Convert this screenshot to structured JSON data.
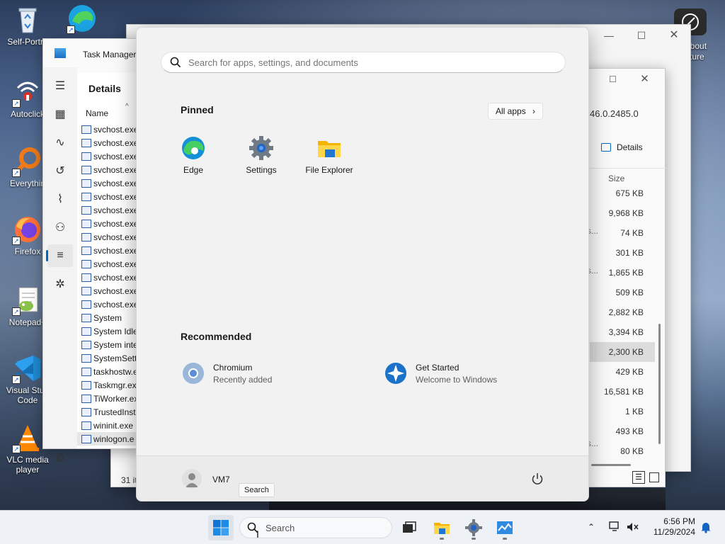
{
  "desktop": {
    "icons": [
      {
        "label": "Self-Portra",
        "icon": "recycle-bin-icon"
      },
      {
        "label": "Autoclick",
        "icon": "autoclick-icon"
      },
      {
        "label": "Everythin",
        "icon": "everything-search-icon"
      },
      {
        "label": "Firefox",
        "icon": "firefox-icon"
      },
      {
        "label": "Notepad+",
        "icon": "notepadpp-icon"
      },
      {
        "label": "Visual Stud Code",
        "icon": "vscode-icon"
      },
      {
        "label": "VLC media player",
        "icon": "vlc-icon"
      }
    ],
    "top_right_label": "dbout cture"
  },
  "task_manager": {
    "title": "Task Manager",
    "section": "Details",
    "column_name": "Name",
    "processes": [
      "svchost.exe",
      "svchost.exe",
      "svchost.exe",
      "svchost.exe",
      "svchost.exe",
      "svchost.exe",
      "svchost.exe",
      "svchost.exe",
      "svchost.exe",
      "svchost.exe",
      "svchost.exe",
      "svchost.exe",
      "svchost.exe",
      "svchost.exe",
      "System",
      "System Idle",
      "System inte",
      "SystemSetti",
      "taskhostw.e",
      "Taskmgr.ex",
      "TiWorker.ex",
      "TrustedInsta",
      "wininit.exe",
      "winlogon.e"
    ],
    "footer_count": "31 it"
  },
  "back_window": {
    "version_text": "46.0.2485.0",
    "details_button": "Details",
    "size_header": "Size",
    "sizes": [
      "675 KB",
      "9,968 KB",
      "74 KB",
      "301 KB",
      "1,865 KB",
      "509 KB",
      "2,882 KB",
      "3,394 KB",
      "2,300 KB",
      "429 KB",
      "16,581 KB",
      "1 KB",
      "493 KB",
      "80 KB"
    ],
    "ellipsis": "s..."
  },
  "start_menu": {
    "search_placeholder": "Search for apps, settings, and documents",
    "pinned_title": "Pinned",
    "all_apps_label": "All apps",
    "pinned": [
      {
        "label": "Edge",
        "icon": "edge-icon"
      },
      {
        "label": "Settings",
        "icon": "settings-gear-icon"
      },
      {
        "label": "File Explorer",
        "icon": "folder-icon"
      }
    ],
    "recommended_title": "Recommended",
    "recommended": [
      {
        "title": "Chromium",
        "subtitle": "Recently added",
        "icon": "chromium-icon"
      },
      {
        "title": "Get Started",
        "subtitle": "Welcome to Windows",
        "icon": "get-started-icon"
      }
    ],
    "user_name": "VM7",
    "tooltip": "Search"
  },
  "taskbar": {
    "search_label": "Search",
    "time": "6:56 PM",
    "date": "11/29/2024"
  },
  "colors": {
    "accent": "#0067c0",
    "start_bg": "#f2f2f2",
    "taskbar_bg": "#eef1f6"
  }
}
